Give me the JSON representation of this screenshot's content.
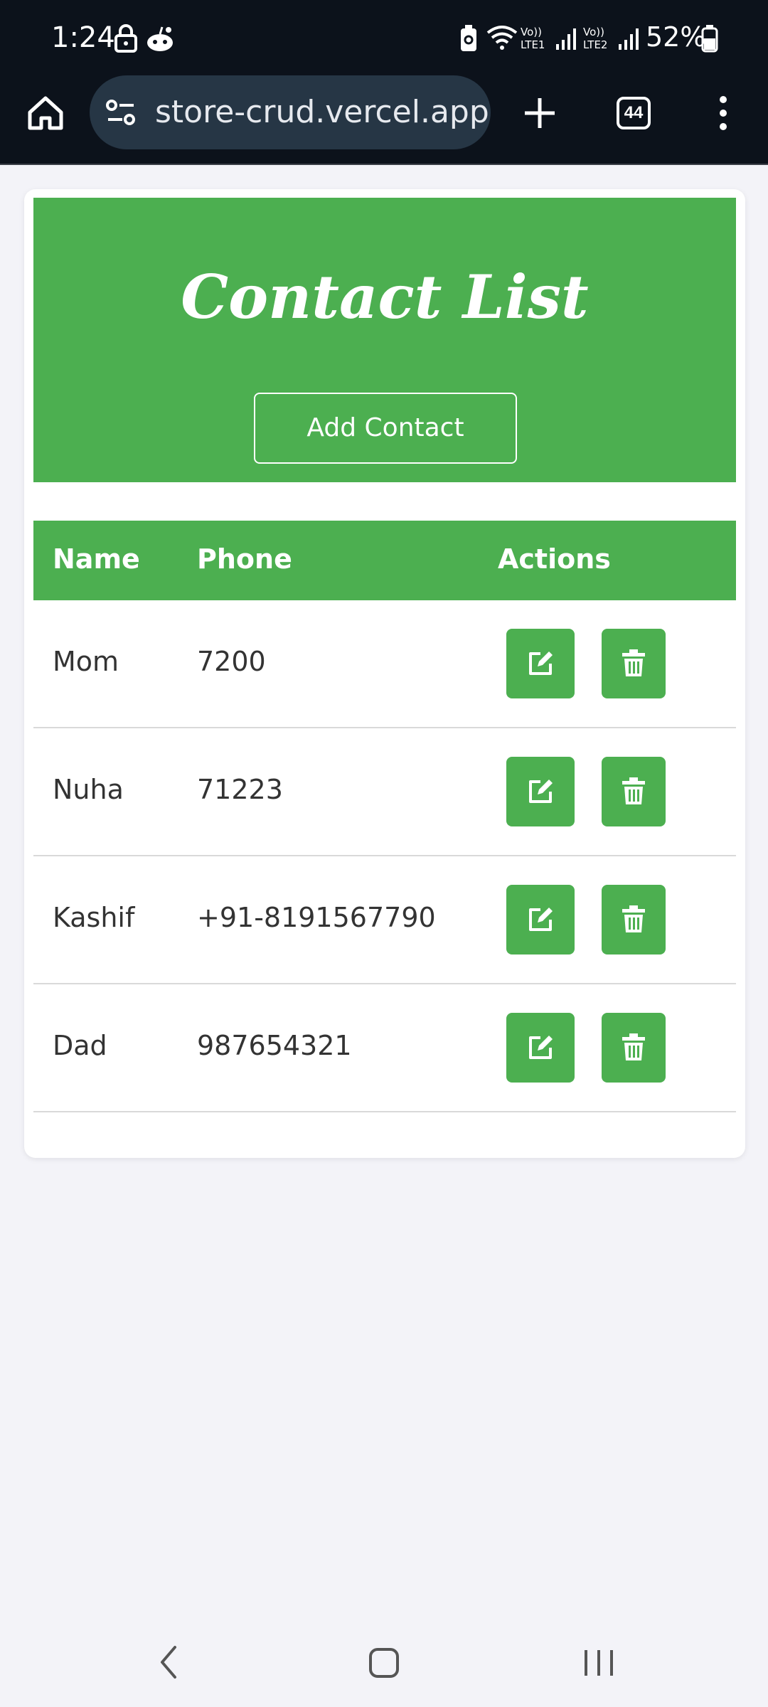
{
  "status_bar": {
    "time": "1:24",
    "battery": "52%",
    "icons": [
      "lock-icon",
      "reddit-icon",
      "battery-saver-icon",
      "wifi-icon",
      "lte1-signal-icon",
      "lte2-signal-icon",
      "battery-icon"
    ]
  },
  "browser": {
    "url": "store-crud.vercel.app",
    "tab_count": "44",
    "icons": [
      "home-icon",
      "site-settings-icon",
      "new-tab-icon",
      "tabs-icon",
      "menu-icon"
    ]
  },
  "page": {
    "title": "Contact List",
    "add_button": "Add Contact",
    "columns": [
      "Name",
      "Phone",
      "Actions"
    ],
    "contacts": [
      {
        "name": "Mom",
        "phone": "7200"
      },
      {
        "name": "Nuha",
        "phone": "71223"
      },
      {
        "name": "Kashif",
        "phone": "+91-8191567790"
      },
      {
        "name": "Dad",
        "phone": "987654321"
      }
    ]
  },
  "colors": {
    "accent": "#4caf50",
    "browser_bg": "#0c121b",
    "url_pill": "#263645",
    "page_bg": "#f3f3f8"
  },
  "nav_bar": {
    "icons": [
      "back-icon",
      "home-nav-icon",
      "recents-icon"
    ]
  }
}
